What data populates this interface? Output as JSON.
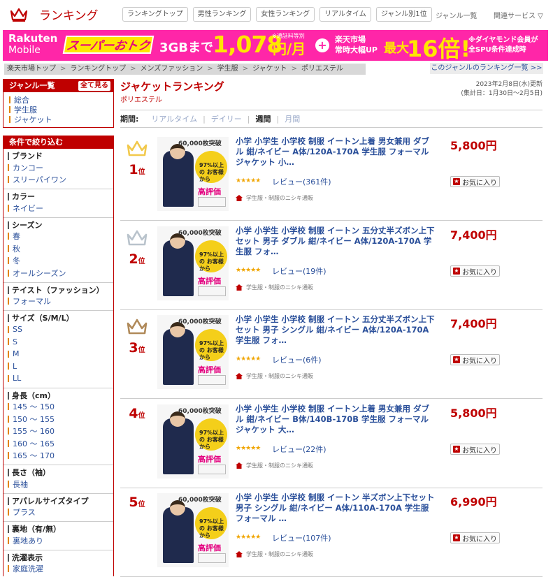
{
  "header": {
    "logo_text": "ランキング",
    "nav": [
      "ランキングトップ",
      "男性ランキング",
      "女性ランキング",
      "リアルタイム",
      "ジャンル別1位"
    ],
    "genre_link": "ジャンル一覧",
    "services_link": "関連サービス ▽"
  },
  "banner": {
    "brand_line1": "Rakuten",
    "brand_line2": "Mobile",
    "campaign": "スーパーおトク",
    "gb": "3GBまで",
    "price": "1,078",
    "price_unit": "円/月",
    "price_note": "※通話料等別",
    "ichiba_line1": "楽天市場",
    "ichiba_line2": "常時大幅UP",
    "max": "最大",
    "bai": "16倍!",
    "diamond_line1": "※ダイヤモンド会員が",
    "diamond_line2": "全SPU条件達成時"
  },
  "breadcrumb": [
    "楽天市場トップ",
    "ランキングトップ",
    "メンズファッション",
    "学生服",
    "ジャケット",
    "ポリエステル"
  ],
  "genre_ranking_link": "このジャンルのランキング一覧 >>",
  "sidebar": {
    "genre_title": "ジャンル一覧",
    "show_all": "全て見る",
    "genres": [
      "総合",
      "学生服",
      "ジャケット"
    ],
    "filter_title": "条件で絞り込む",
    "groups": [
      {
        "title": "ブランド",
        "items": [
          "カンコー",
          "スリーパイワン"
        ]
      },
      {
        "title": "カラー",
        "items": [
          "ネイビー"
        ]
      },
      {
        "title": "シーズン",
        "items": [
          "春",
          "秋",
          "冬",
          "オールシーズン"
        ]
      },
      {
        "title": "テイスト（ファッション）",
        "items": [
          "フォーマル"
        ]
      },
      {
        "title": "サイズ（S/M/L）",
        "items": [
          "SS",
          "S",
          "M",
          "L",
          "LL"
        ]
      },
      {
        "title": "身長（cm）",
        "items": [
          "145 ～ 150",
          "150 ～ 155",
          "155 ～ 160",
          "160 ～ 165",
          "165 ～ 170"
        ]
      },
      {
        "title": "長さ（袖）",
        "items": [
          "長袖"
        ]
      },
      {
        "title": "アパレルサイズタイプ",
        "items": [
          "プラス"
        ]
      },
      {
        "title": "裏地（有/無）",
        "items": [
          "裏地あり"
        ]
      },
      {
        "title": "洗濯表示",
        "items": [
          "家庭洗濯"
        ]
      }
    ]
  },
  "main": {
    "title": "ジャケットランキング",
    "subgenre": "ポリエステル",
    "update_line1": "2023年2月8日(水)更新",
    "update_line2": "(集計日：1月30日～2月5日)",
    "period_label": "期間:",
    "periods": [
      "リアルタイム",
      "デイリー",
      "週間",
      "月間"
    ],
    "active_period": "週間",
    "fav_label": "お気に入り",
    "shop_name": "学生服・制服のニシキ通販",
    "thumb_text": {
      "t1": "60,000枚突破",
      "t2": "97%以上の お客様から",
      "t3": "高評価"
    },
    "items": [
      {
        "rank": "1",
        "rank_suffix": "位",
        "crown": "gold",
        "title": "小学 小学生 小学校 制服 イートン上着 男女兼用 ダブル 紺/ネイビー A体/120A-170A 学生服 フォーマル ジャケット 小…",
        "stars": "★★★★★",
        "review": "レビュー(361件)",
        "price": "5,800円"
      },
      {
        "rank": "2",
        "rank_suffix": "位",
        "crown": "silver",
        "title": "小学 小学生 小学校 制服 イートン 五分丈半ズボン上下セット 男子 ダブル 紺/ネイビー A体/120A-170A 学生服 フォ…",
        "stars": "★★★★★",
        "review": "レビュー(19件)",
        "price": "7,400円"
      },
      {
        "rank": "3",
        "rank_suffix": "位",
        "crown": "bronze",
        "title": "小学 小学生 小学校 制服 イートン 五分丈半ズボン上下セット 男子 シングル 紺/ネイビー A体/120A-170A 学生服 フォ…",
        "stars": "★★★★★",
        "review": "レビュー(6件)",
        "price": "7,400円"
      },
      {
        "rank": "4",
        "rank_suffix": "位",
        "crown": "",
        "title": "小学 小学生 小学校 制服 イートン上着 男女兼用 ダブル 紺/ネイビー B体/140B-170B 学生服 フォーマル ジャケット 大…",
        "stars": "★★★★★",
        "review": "レビュー(22件)",
        "price": "5,800円"
      },
      {
        "rank": "5",
        "rank_suffix": "位",
        "crown": "",
        "title": "小学 小学生 小学校 制服 イートン 半ズボン上下セット 男子 シングル 紺/ネイビー A体/110A-170A 学生服 フォーマル …",
        "stars": "★★★★★",
        "review": "レビュー(107件)",
        "price": "6,990円"
      }
    ]
  },
  "colors": {
    "brand_red": "#bf0000",
    "gold": "#f2c94c",
    "silver": "#b9c3cc",
    "bronze": "#b08a5a",
    "link_blue": "#2a4f9a"
  }
}
